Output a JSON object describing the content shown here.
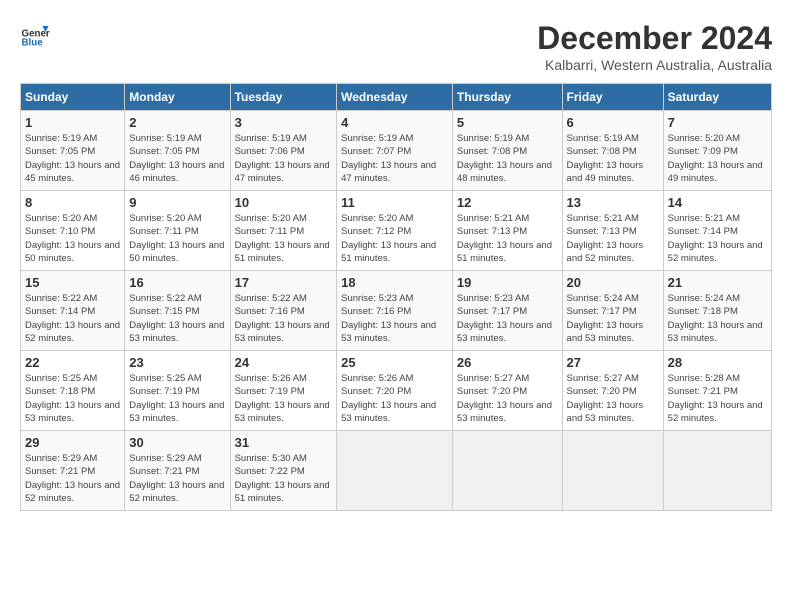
{
  "header": {
    "logo_general": "General",
    "logo_blue": "Blue",
    "title": "December 2024",
    "subtitle": "Kalbarri, Western Australia, Australia"
  },
  "weekdays": [
    "Sunday",
    "Monday",
    "Tuesday",
    "Wednesday",
    "Thursday",
    "Friday",
    "Saturday"
  ],
  "weeks": [
    [
      {
        "day": "1",
        "rise": "5:19 AM",
        "set": "7:05 PM",
        "daylight": "13 hours and 45 minutes."
      },
      {
        "day": "2",
        "rise": "5:19 AM",
        "set": "7:05 PM",
        "daylight": "13 hours and 46 minutes."
      },
      {
        "day": "3",
        "rise": "5:19 AM",
        "set": "7:06 PM",
        "daylight": "13 hours and 47 minutes."
      },
      {
        "day": "4",
        "rise": "5:19 AM",
        "set": "7:07 PM",
        "daylight": "13 hours and 47 minutes."
      },
      {
        "day": "5",
        "rise": "5:19 AM",
        "set": "7:08 PM",
        "daylight": "13 hours and 48 minutes."
      },
      {
        "day": "6",
        "rise": "5:19 AM",
        "set": "7:08 PM",
        "daylight": "13 hours and 49 minutes."
      },
      {
        "day": "7",
        "rise": "5:20 AM",
        "set": "7:09 PM",
        "daylight": "13 hours and 49 minutes."
      }
    ],
    [
      {
        "day": "8",
        "rise": "5:20 AM",
        "set": "7:10 PM",
        "daylight": "13 hours and 50 minutes."
      },
      {
        "day": "9",
        "rise": "5:20 AM",
        "set": "7:11 PM",
        "daylight": "13 hours and 50 minutes."
      },
      {
        "day": "10",
        "rise": "5:20 AM",
        "set": "7:11 PM",
        "daylight": "13 hours and 51 minutes."
      },
      {
        "day": "11",
        "rise": "5:20 AM",
        "set": "7:12 PM",
        "daylight": "13 hours and 51 minutes."
      },
      {
        "day": "12",
        "rise": "5:21 AM",
        "set": "7:13 PM",
        "daylight": "13 hours and 51 minutes."
      },
      {
        "day": "13",
        "rise": "5:21 AM",
        "set": "7:13 PM",
        "daylight": "13 hours and 52 minutes."
      },
      {
        "day": "14",
        "rise": "5:21 AM",
        "set": "7:14 PM",
        "daylight": "13 hours and 52 minutes."
      }
    ],
    [
      {
        "day": "15",
        "rise": "5:22 AM",
        "set": "7:14 PM",
        "daylight": "13 hours and 52 minutes."
      },
      {
        "day": "16",
        "rise": "5:22 AM",
        "set": "7:15 PM",
        "daylight": "13 hours and 53 minutes."
      },
      {
        "day": "17",
        "rise": "5:22 AM",
        "set": "7:16 PM",
        "daylight": "13 hours and 53 minutes."
      },
      {
        "day": "18",
        "rise": "5:23 AM",
        "set": "7:16 PM",
        "daylight": "13 hours and 53 minutes."
      },
      {
        "day": "19",
        "rise": "5:23 AM",
        "set": "7:17 PM",
        "daylight": "13 hours and 53 minutes."
      },
      {
        "day": "20",
        "rise": "5:24 AM",
        "set": "7:17 PM",
        "daylight": "13 hours and 53 minutes."
      },
      {
        "day": "21",
        "rise": "5:24 AM",
        "set": "7:18 PM",
        "daylight": "13 hours and 53 minutes."
      }
    ],
    [
      {
        "day": "22",
        "rise": "5:25 AM",
        "set": "7:18 PM",
        "daylight": "13 hours and 53 minutes."
      },
      {
        "day": "23",
        "rise": "5:25 AM",
        "set": "7:19 PM",
        "daylight": "13 hours and 53 minutes."
      },
      {
        "day": "24",
        "rise": "5:26 AM",
        "set": "7:19 PM",
        "daylight": "13 hours and 53 minutes."
      },
      {
        "day": "25",
        "rise": "5:26 AM",
        "set": "7:20 PM",
        "daylight": "13 hours and 53 minutes."
      },
      {
        "day": "26",
        "rise": "5:27 AM",
        "set": "7:20 PM",
        "daylight": "13 hours and 53 minutes."
      },
      {
        "day": "27",
        "rise": "5:27 AM",
        "set": "7:20 PM",
        "daylight": "13 hours and 53 minutes."
      },
      {
        "day": "28",
        "rise": "5:28 AM",
        "set": "7:21 PM",
        "daylight": "13 hours and 52 minutes."
      }
    ],
    [
      {
        "day": "29",
        "rise": "5:29 AM",
        "set": "7:21 PM",
        "daylight": "13 hours and 52 minutes."
      },
      {
        "day": "30",
        "rise": "5:29 AM",
        "set": "7:21 PM",
        "daylight": "13 hours and 52 minutes."
      },
      {
        "day": "31",
        "rise": "5:30 AM",
        "set": "7:22 PM",
        "daylight": "13 hours and 51 minutes."
      },
      null,
      null,
      null,
      null
    ]
  ]
}
